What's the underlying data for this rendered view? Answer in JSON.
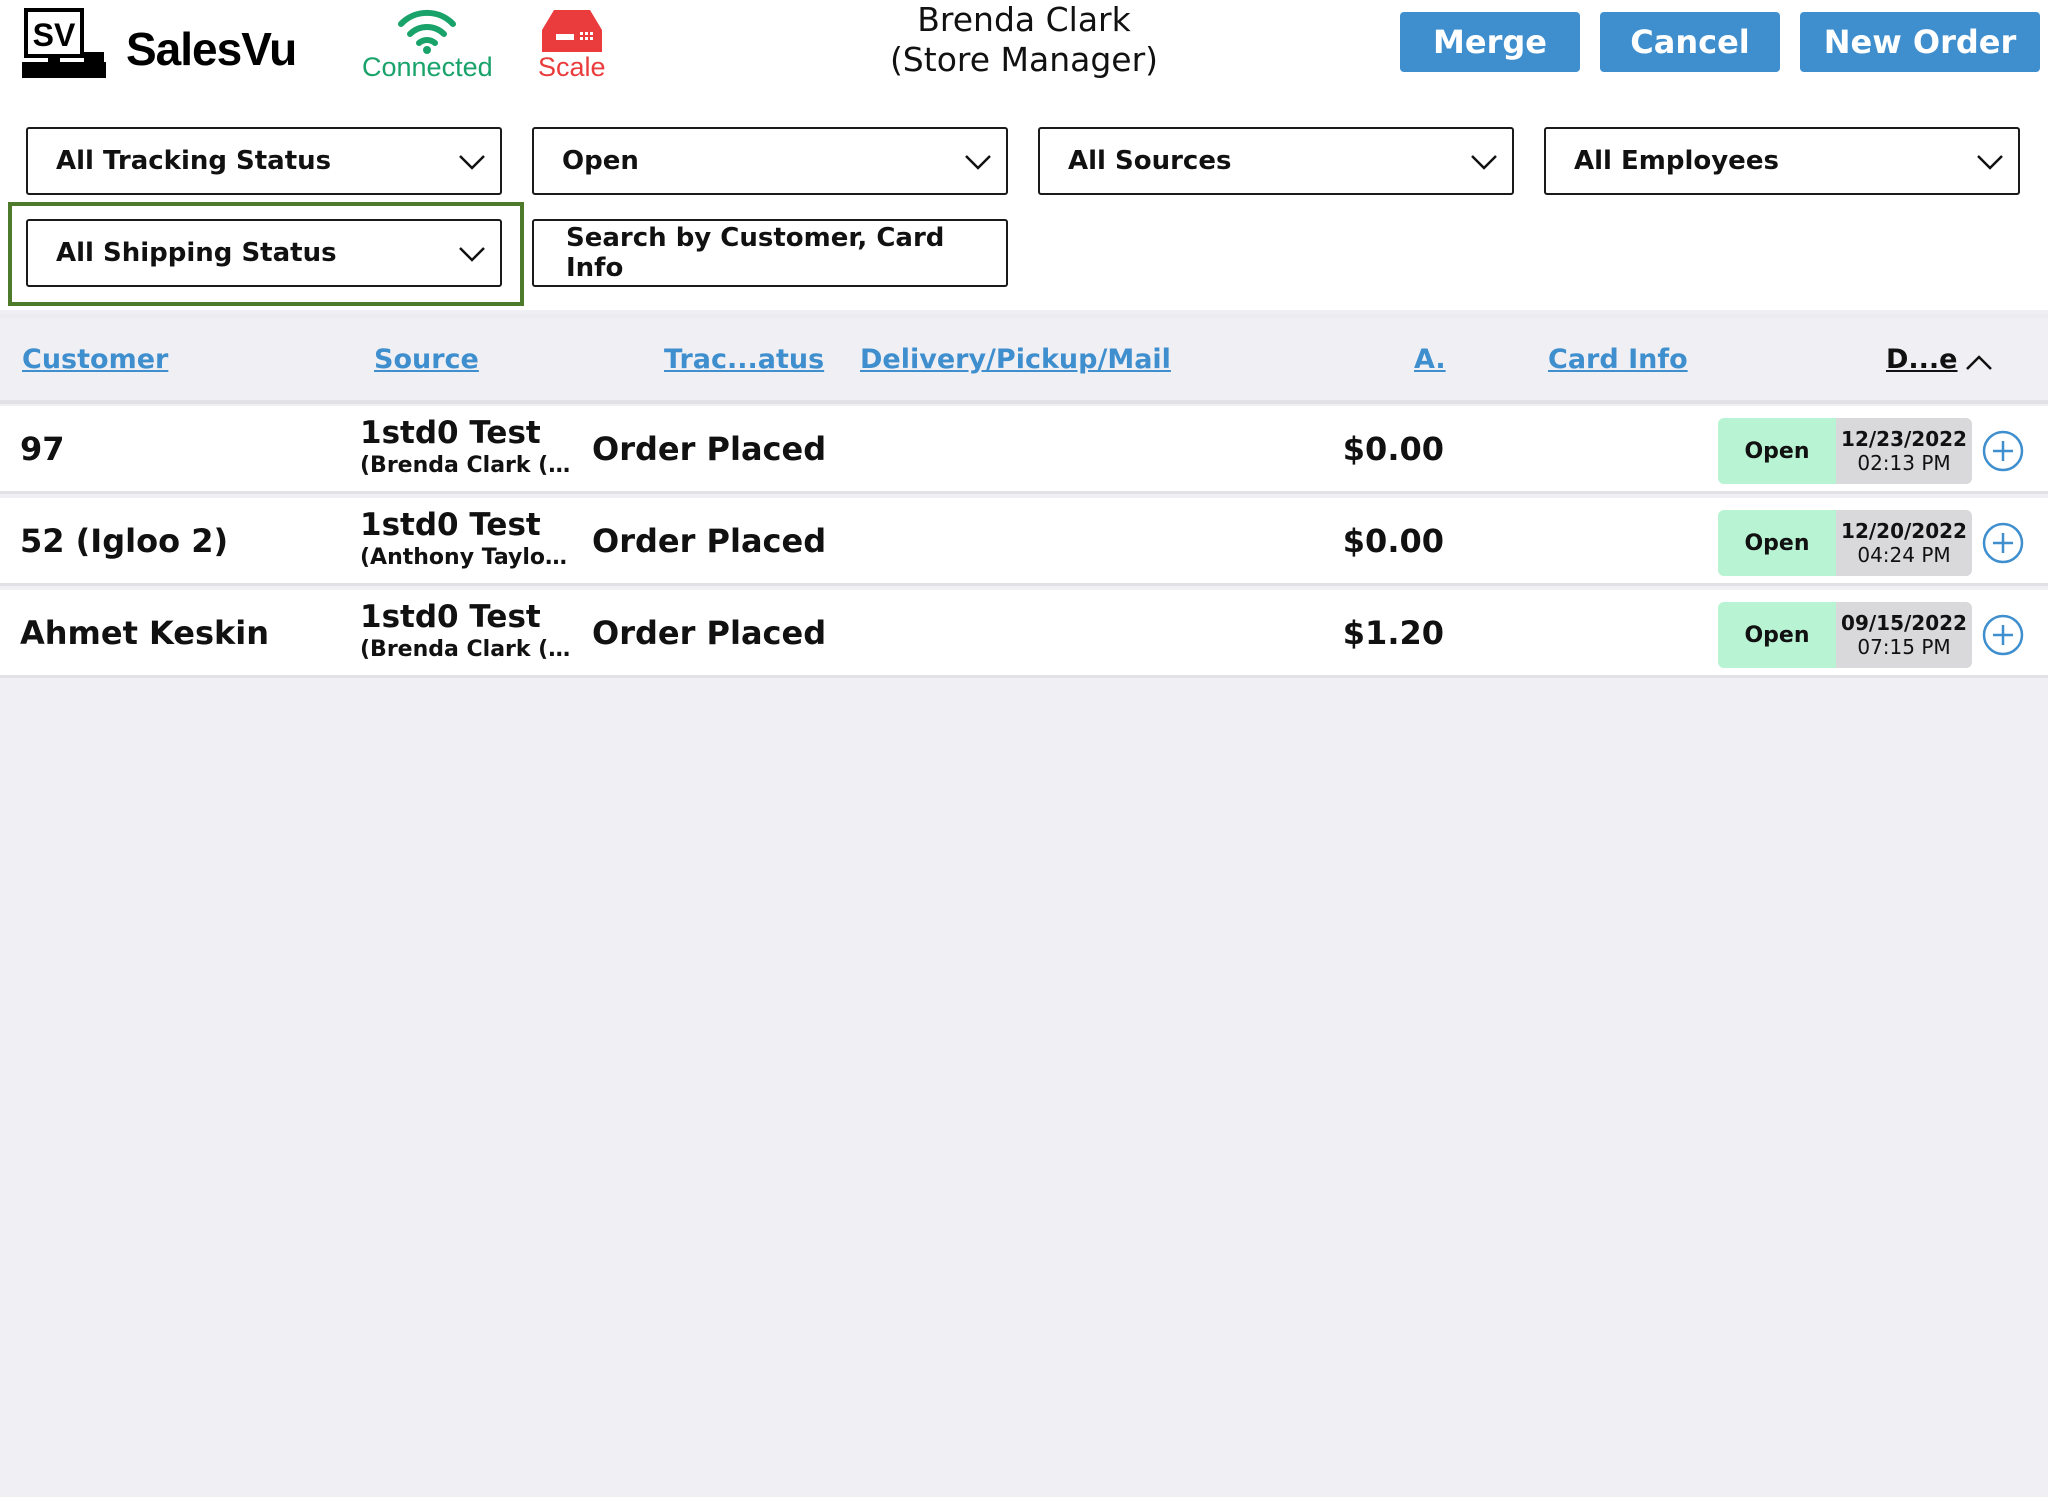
{
  "header": {
    "logo_text": "SalesVu",
    "connection_label": "Connected",
    "scale_label": "Scale",
    "user_name": "Brenda Clark",
    "user_role": "(Store Manager)",
    "buttons": {
      "merge": "Merge",
      "cancel": "Cancel",
      "new_order": "New Order"
    }
  },
  "filters": {
    "tracking_status": "All Tracking Status",
    "order_status": "Open",
    "sources": "All Sources",
    "employees": "All Employees",
    "shipping_status": "All Shipping Status",
    "search_placeholder": "Search by Customer, Card Info"
  },
  "columns": {
    "customer": "Customer",
    "source": "Source",
    "tracking": "Trac...atus",
    "delivery": "Delivery/Pickup/Mail",
    "amount": "A.",
    "card_info": "Card Info",
    "date": "D...e"
  },
  "orders": [
    {
      "customer": "97",
      "source": "1std0 Test",
      "source_sub": "(Brenda  Clark (...",
      "tracking": "Order Placed",
      "amount": "$0.00",
      "status": "Open",
      "date": "12/23/2022",
      "time": "02:13 PM"
    },
    {
      "customer": "52 (Igloo 2)",
      "source": "1std0 Test",
      "source_sub": "(Anthony  Taylor...",
      "tracking": "Order Placed",
      "amount": "$0.00",
      "status": "Open",
      "date": "12/20/2022",
      "time": "04:24 PM"
    },
    {
      "customer": "Ahmet Keskin",
      "source": "1std0 Test",
      "source_sub": "(Brenda  Clark (...",
      "tracking": "Order Placed",
      "amount": "$1.20",
      "status": "Open",
      "date": "09/15/2022",
      "time": "07:15 PM"
    }
  ],
  "colors": {
    "accent": "#3f8fcf",
    "connected": "#19a36b",
    "scale": "#ea3c3c",
    "status_open_bg": "#b8f3d4",
    "focus_ring": "#4e7a2c"
  }
}
